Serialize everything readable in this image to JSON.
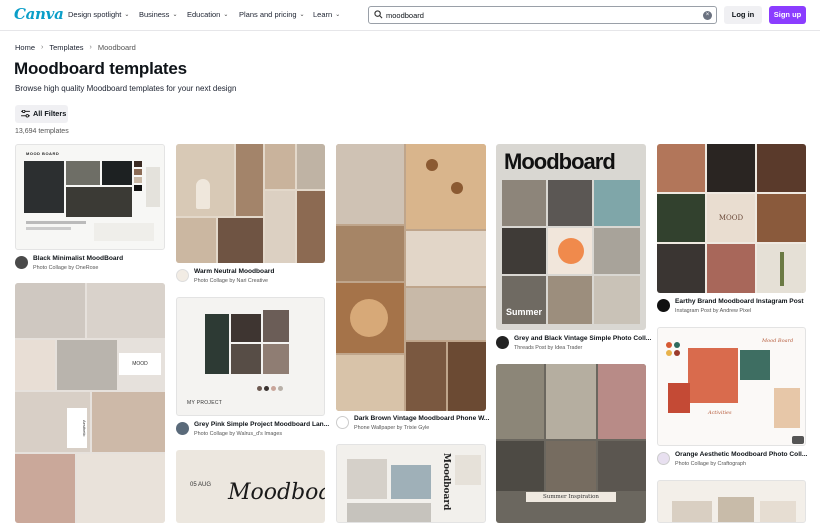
{
  "header": {
    "logo": "Canva",
    "nav": [
      {
        "label": "Design spotlight"
      },
      {
        "label": "Business"
      },
      {
        "label": "Education"
      },
      {
        "label": "Plans and pricing"
      },
      {
        "label": "Learn"
      }
    ],
    "search_value": "moodboard",
    "login_label": "Log in",
    "signup_label": "Sign up"
  },
  "breadcrumb": {
    "home": "Home",
    "templates": "Templates",
    "current": "Moodboard"
  },
  "page": {
    "title": "Moodboard templates",
    "subtitle": "Browse high quality Moodboard templates for your next design",
    "filters_label": "All Filters",
    "count": "13,694 templates"
  },
  "templates": [
    {
      "title": "Black Minimalist MoodBoard",
      "sub": "Photo Collage by OneRose"
    },
    {
      "title": "Warm Neutral Moodboard",
      "sub": "Photo Collage by Nari Creative"
    },
    {
      "title": "Grey Pink Simple Project Moodboard Lan...",
      "sub": "Photo Collage by Walrus_d's Images"
    },
    {
      "title": "Dark Brown Vintage Moodboard Phone W...",
      "sub": "Phone Wallpaper by Trixie Gyle"
    },
    {
      "title": "Grey and Black Vintage Simple Photo Coll...",
      "sub": "Threads Post by Idea Trader"
    },
    {
      "title": "Earthy Brand Moodboard Instagram Post",
      "sub": "Instagram Post by Andrew Pixel"
    },
    {
      "title": "Orange Aesthetic Moodboard Photo Coll...",
      "sub": "Photo Collage by Craftograph"
    }
  ],
  "thumb_text": {
    "black_minimalist": "MOOD BOARD",
    "grey_pink": "MY PROJECT",
    "moodboard_big": "Moodboard",
    "summer": "Summer",
    "summer_inspiration": "Summer Inspiration",
    "mood_script": "Moodboard",
    "date": "05 AUG",
    "mood": "MOOD",
    "aesthetic": "Aesthetic",
    "mood_board_orange": "Mood Board",
    "activities": "Activities",
    "vertical_mood": "Moodboard"
  }
}
